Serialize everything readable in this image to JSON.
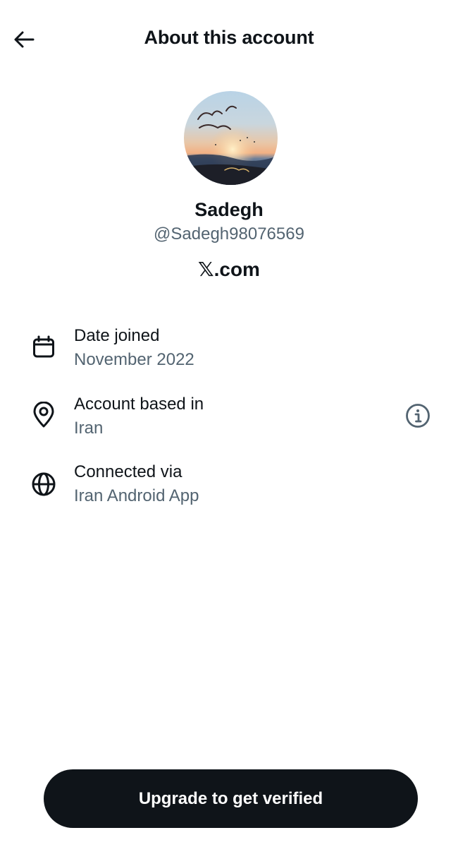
{
  "header": {
    "title": "About this account",
    "back_icon": "arrow-left-icon"
  },
  "profile": {
    "avatar_icon": "profile-avatar",
    "name": "Sadegh",
    "handle": "@Sadegh98076569",
    "platform": "𝕏.com"
  },
  "details": [
    {
      "icon": "calendar-icon",
      "label": "Date joined",
      "value": "November 2022"
    },
    {
      "icon": "location-pin-icon",
      "label": "Account based in",
      "value": "Iran",
      "action_icon": "info-icon"
    },
    {
      "icon": "globe-icon",
      "label": "Connected via",
      "value": "Iran Android App"
    }
  ],
  "cta": {
    "label": "Upgrade to get verified"
  },
  "colors": {
    "text": "#0f1419",
    "secondary_text": "#536471",
    "button_bg": "#0f1419",
    "background": "#ffffff"
  }
}
